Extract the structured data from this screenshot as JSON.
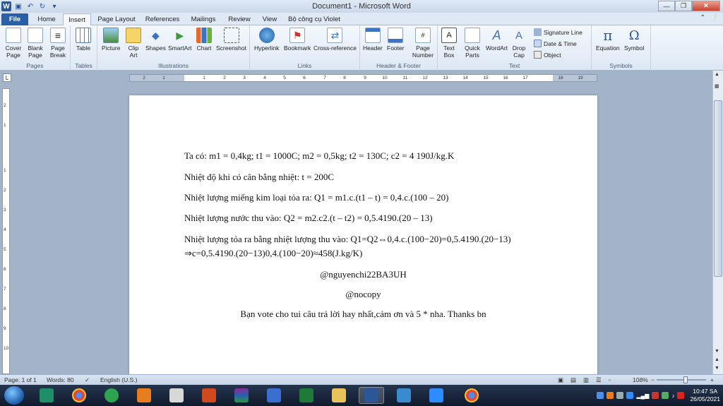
{
  "window": {
    "title": "Document1 - Microsoft Word"
  },
  "tabs": [
    "File",
    "Home",
    "Insert",
    "Page Layout",
    "References",
    "Mailings",
    "Review",
    "View",
    "Bộ công cụ Violet"
  ],
  "ribbon": {
    "pages": {
      "label": "Pages",
      "cover_page": "Cover Page",
      "blank_page": "Blank Page",
      "page_break": "Page Break"
    },
    "tables": {
      "label": "Tables",
      "table": "Table"
    },
    "illustrations": {
      "label": "Illustrations",
      "picture": "Picture",
      "clip_art": "Clip Art",
      "shapes": "Shapes",
      "smartart": "SmartArt",
      "chart": "Chart",
      "screenshot": "Screenshot"
    },
    "links": {
      "label": "Links",
      "hyperlink": "Hyperlink",
      "bookmark": "Bookmark",
      "cross_reference": "Cross-reference"
    },
    "header_footer": {
      "label": "Header & Footer",
      "header": "Header",
      "footer": "Footer",
      "page_number": "Page Number"
    },
    "text": {
      "label": "Text",
      "text_box": "Text Box",
      "quick_parts": "Quick Parts",
      "wordart": "WordArt",
      "drop_cap": "Drop Cap",
      "signature_line": "Signature Line",
      "date_time": "Date & Time",
      "object": "Object"
    },
    "symbols": {
      "label": "Symbols",
      "equation": "Equation",
      "symbol": "Symbol"
    }
  },
  "ruler": {
    "h_ticks": [
      "2",
      "1",
      "1",
      "2",
      "3",
      "4",
      "5",
      "6",
      "7",
      "8",
      "9",
      "10",
      "11",
      "12",
      "13",
      "14",
      "15",
      "16",
      "17",
      "18",
      "19"
    ],
    "v_ticks": [
      "2",
      "1",
      "1",
      "2",
      "3",
      "4",
      "5",
      "6",
      "7",
      "8",
      "9",
      "10"
    ]
  },
  "document": {
    "line1": "Ta có: m1 = 0,4kg; t1 = 1000C; m2 = 0,5kg; t2 = 130C; c2 = 4 190J/kg.K",
    "line2": "Nhiệt độ khi có cân bằng nhiệt: t = 200C",
    "line3": "Nhiệt lượng miếng kim loại tỏa ra: Q1 = m1.c.(t1 – t) = 0,4.c.(100 – 20)",
    "line4": "Nhiệt lượng nước thu vào: Q2 = m2.c2.(t – t2) = 0,5.4190.(20 – 13)",
    "line5": "Nhiệt lượng tỏa ra bằng nhiệt lượng thu vào: Q1=Q2⇔0,4.c.(100−20)=0,5.4190.(20−13)",
    "line6": "⇒c=0,5.4190.(20−13)0,4.(100−20)≈458(J.kg/K)",
    "line7": "@nguyenchi22BA3UH",
    "line8": "@nocopy",
    "line9": "Bạn vote cho tui câu trả lời hay nhất,cảm ơn và 5 * nha. Thanks bn"
  },
  "status": {
    "page": "Page: 1 of 1",
    "words": "Words: 80",
    "language": "English (U.S.)",
    "zoom": "108%"
  },
  "clock": {
    "time": "10:47 SA",
    "date": "26/05/2021"
  },
  "colors": {
    "file_tab": "#2a5fa8",
    "ribbon_bg": "#dde8f5",
    "workspace": "#a3b4c9",
    "squiggle": "#dd2222"
  }
}
